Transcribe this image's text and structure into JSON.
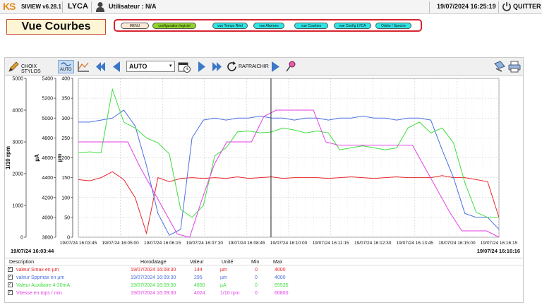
{
  "header": {
    "logo": "KS",
    "version": "SIVIEW v6.28.1",
    "site": "LYCA",
    "user_label": "Utilisateur : N/A",
    "datetime": "19/07/2024 16:25:19",
    "quit_label": "QUITTER"
  },
  "page_title": "Vue Courbes",
  "nav": {
    "items": [
      {
        "label": "MENU",
        "bg": "#fde9d6"
      },
      {
        "label": "configuration logiciel",
        "bg": "#8fd62a"
      },
      {
        "label": "vue Temps Réel",
        "bg": "#2ee6e6"
      },
      {
        "label": "vue Alarmes",
        "bg": "#2ee6e6"
      },
      {
        "label": "vue Courbes",
        "bg": "#2ee6e6"
      },
      {
        "label": "vue Config LYCA",
        "bg": "#2ee6e6"
      },
      {
        "label": "Orbite / Spectre",
        "bg": "#2ee6e6"
      }
    ]
  },
  "toolbar": {
    "choix_stylos": "CHOIX STYLOS",
    "auto_toggle": "AUTO",
    "mode_value": "AUTO",
    "refresh": "RAFRAICHIR"
  },
  "chart_data": {
    "type": "line",
    "x": [
      "19/07/24 16:03:45",
      "19/07/24 16:05:00",
      "19/07/24 16:06:15",
      "19/07/24 16:07:30",
      "19/07/24 16:08:45",
      "19/07/24 16:10:00",
      "19/07/24 16:11:15",
      "19/07/24 16:12:30",
      "19/07/24 16:13:45",
      "19/07/24 16:15:00",
      "19/07/24 16:16:15"
    ],
    "start_label": "19/07/24 16:03:44",
    "end_label": "19/07/24 16:16:16",
    "axes": [
      {
        "label": "1/10 rpm",
        "ticks": [
          "5000",
          "4000",
          "3000",
          "2000",
          "1000",
          "0"
        ],
        "range": [
          0,
          5000
        ]
      },
      {
        "label": "µA",
        "ticks": [
          "5400",
          "5200",
          "5000",
          "4800",
          "4600",
          "4400",
          "4200",
          "4000",
          "3800"
        ],
        "range": [
          3800,
          5400
        ]
      },
      {
        "label": "µm",
        "ticks": [
          "400",
          "350",
          "300",
          "250",
          "200",
          "150",
          "100",
          "50",
          "0"
        ],
        "range": [
          0,
          400
        ]
      }
    ],
    "grid": true,
    "series": [
      {
        "name": "valeur Smax en µm",
        "color": "#e8262a",
        "values": [
          145,
          142,
          150,
          165,
          145,
          100,
          10,
          150,
          140,
          148,
          150,
          148,
          150,
          148,
          152,
          148,
          150,
          152,
          148,
          150,
          150,
          150,
          148,
          150,
          152,
          150,
          148,
          150,
          152,
          150,
          150,
          150,
          155,
          150,
          150,
          145,
          140,
          50
        ]
      },
      {
        "name": "valeur Sppmax en µm",
        "color": "#4a6fe0",
        "values": [
          290,
          290,
          295,
          300,
          320,
          280,
          180,
          60,
          5,
          20,
          250,
          295,
          300,
          295,
          300,
          300,
          305,
          300,
          300,
          295,
          300,
          300,
          295,
          300,
          300,
          305,
          300,
          300,
          295,
          300,
          300,
          295,
          220,
          150,
          60,
          50,
          50,
          20
        ]
      },
      {
        "name": "Valeur Auxiliaire 4-20mA",
        "color": "#3ede3e",
        "values": [
          4650,
          4660,
          4650,
          5290,
          4960,
          4900,
          4800,
          4750,
          4640,
          4080,
          4000,
          4120,
          4620,
          4700,
          4860,
          4870,
          4850,
          4860,
          4900,
          4880,
          4850,
          4870,
          4850,
          4680,
          4700,
          4720,
          4700,
          4680,
          4700,
          4900,
          4960,
          4850,
          4900,
          4750,
          4350,
          4050,
          4000,
          4000
        ]
      },
      {
        "name": "Vitesse en tops / min",
        "color": "#e43ee4",
        "values": [
          3000,
          3000,
          3000,
          3000,
          3000,
          2200,
          1500,
          800,
          100,
          0,
          1200,
          2300,
          3000,
          3000,
          3000,
          3800,
          4000,
          4000,
          4000,
          4000,
          3000,
          2900,
          2900,
          2900,
          2900,
          2900,
          2900,
          2900,
          2200,
          1500,
          800,
          200,
          200,
          200,
          0
        ]
      }
    ]
  },
  "legend": {
    "headers": [
      "Description",
      "Horodatage",
      "Valeur",
      "Unité",
      "Min",
      "Max"
    ],
    "rows": [
      {
        "description": "valeur Smax en µm",
        "time": "19/07/2024 16:09:30",
        "value": "144",
        "unit": "µm",
        "min": "0",
        "max": "4000",
        "color": "#e8262a"
      },
      {
        "description": "valeur Sppmax en µm",
        "time": "19/07/2024 16:09:30",
        "value": "295",
        "unit": "µm",
        "min": "0",
        "max": "4000",
        "color": "#4a6fe0"
      },
      {
        "description": "Valeur Auxiliaire 4-20mA",
        "time": "19/07/2024 16:09:30",
        "value": "4850",
        "unit": "µA",
        "min": "0",
        "max": "65535",
        "color": "#3ede3e"
      },
      {
        "description": "Vitesse en tops / min",
        "time": "19/07/2024 16:09:30",
        "value": "4024",
        "unit": "1/10 rpm",
        "min": "0",
        "max": "60800",
        "color": "#e43ee4"
      }
    ]
  }
}
